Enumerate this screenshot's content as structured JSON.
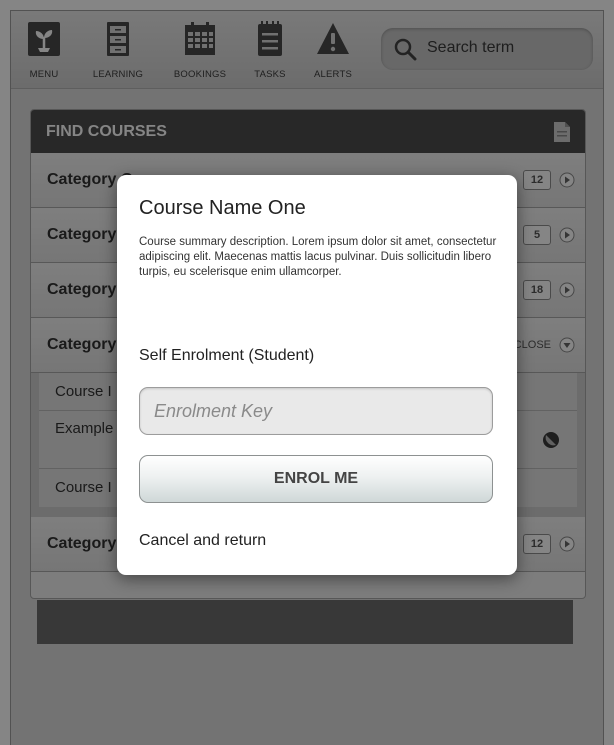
{
  "toolbar": {
    "items": [
      {
        "label": "MENU",
        "icon": "plant-icon"
      },
      {
        "label": "LEARNING",
        "icon": "cabinet-icon"
      },
      {
        "label": "BOOKINGS",
        "icon": "calendar-icon"
      },
      {
        "label": "TASKS",
        "icon": "notepad-icon"
      },
      {
        "label": "ALERTS",
        "icon": "warning-icon"
      }
    ],
    "search": {
      "placeholder": "Search term",
      "icon": "search-icon"
    }
  },
  "panel": {
    "title": "FIND COURSES",
    "categories": [
      {
        "label": "Category One",
        "count": "12"
      },
      {
        "label": "Category",
        "count": "5"
      },
      {
        "label": "Category",
        "count": "18"
      },
      {
        "label": "Category",
        "action": "CLOSE"
      },
      {
        "label": "Category",
        "count": "12"
      }
    ],
    "courses": [
      {
        "label": "Course I"
      },
      {
        "label": "Example tempor a"
      },
      {
        "label": "Course I"
      }
    ]
  },
  "modal": {
    "title": "Course Name One",
    "description": "Course summary description. Lorem ipsum dolor sit amet, consectetur adipiscing elit. Maecenas mattis lacus pulvinar. Duis sollicitudin libero turpis, eu scelerisque enim ullamcorper.",
    "subtitle": "Self Enrolment (Student)",
    "key_placeholder": "Enrolment Key",
    "enrol_label": "ENROL ME",
    "cancel_label": "Cancel and return"
  },
  "colors": {
    "header_bg": "#4d4d4d",
    "overlay": "rgba(0,0,0,0.48)",
    "button_gradient_end": "#cfd8d8"
  }
}
